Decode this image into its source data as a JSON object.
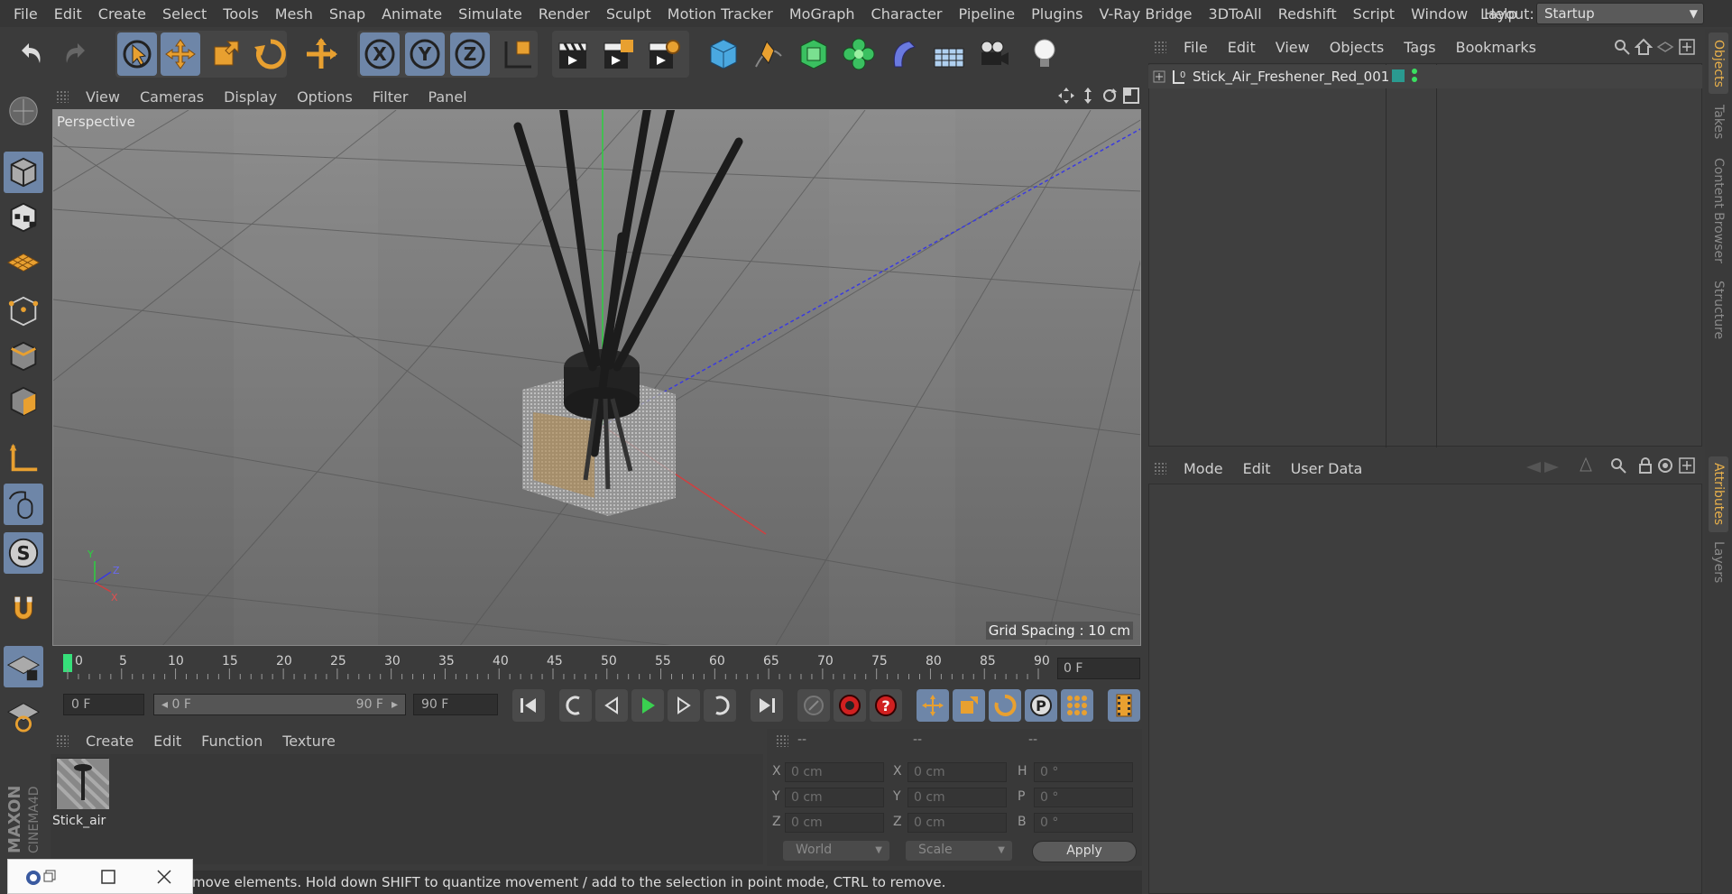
{
  "menubar": {
    "items": [
      "File",
      "Edit",
      "Create",
      "Select",
      "Tools",
      "Mesh",
      "Snap",
      "Animate",
      "Simulate",
      "Render",
      "Sculpt",
      "Motion Tracker",
      "MoGraph",
      "Character",
      "Pipeline",
      "Plugins",
      "V-Ray Bridge",
      "3DToAll",
      "Redshift",
      "Script",
      "Window",
      "Help"
    ],
    "layout_label": "Layout:",
    "layout_value": "Startup"
  },
  "toolbar": {
    "axis_x": "X",
    "axis_y": "Y",
    "axis_z": "Z"
  },
  "left_toolbar": {
    "sculpt_symbol": "S"
  },
  "viewport": {
    "menu": [
      "View",
      "Cameras",
      "Display",
      "Options",
      "Filter",
      "Panel"
    ],
    "label": "Perspective",
    "grid_spacing": "Grid Spacing : 10 cm",
    "axis_y": "Y",
    "axis_z": "Z",
    "axis_x": "X"
  },
  "timeline": {
    "ticks": [
      "0",
      "5",
      "10",
      "15",
      "20",
      "25",
      "30",
      "35",
      "40",
      "45",
      "50",
      "55",
      "60",
      "65",
      "70",
      "75",
      "80",
      "85",
      "90"
    ],
    "current_frame": "0 F"
  },
  "transport": {
    "start_field": "0 F",
    "range_start": "0 F",
    "range_end": "90 F",
    "end_field": "90 F"
  },
  "material_manager": {
    "menu": [
      "Create",
      "Edit",
      "Function",
      "Texture"
    ],
    "material_name": "Stick_air"
  },
  "coordinates": {
    "headers": [
      "--",
      "--",
      "--"
    ],
    "rows": [
      {
        "l1": "X",
        "v1": "0 cm",
        "l2": "X",
        "v2": "0 cm",
        "l3": "H",
        "v3": "0 °"
      },
      {
        "l1": "Y",
        "v1": "0 cm",
        "l2": "Y",
        "v2": "0 cm",
        "l3": "P",
        "v3": "0 °"
      },
      {
        "l1": "Z",
        "v1": "0 cm",
        "l2": "Z",
        "v2": "0 cm",
        "l3": "B",
        "v3": "0 °"
      }
    ],
    "space": "World",
    "mode": "Scale",
    "apply": "Apply"
  },
  "status": {
    "text": "move elements. Hold down SHIFT to quantize movement / add to the selection in point mode, CTRL to remove."
  },
  "object_manager": {
    "menu": [
      "File",
      "Edit",
      "View",
      "Objects",
      "Tags",
      "Bookmarks"
    ],
    "object_name": "Stick_Air_Freshener_Red_001"
  },
  "attribute_manager": {
    "menu": [
      "Mode",
      "Edit",
      "User Data"
    ]
  },
  "right_tabs": {
    "top": [
      "Objects",
      "Takes",
      "Content Browser",
      "Structure"
    ],
    "bottom": [
      "Attributes",
      "Layers"
    ]
  },
  "brand": "MAXON CINEMA4D",
  "colors": {
    "accent_blue": "#6e86a8",
    "orange": "#e8a030",
    "tab_active": "#e8b04a"
  }
}
